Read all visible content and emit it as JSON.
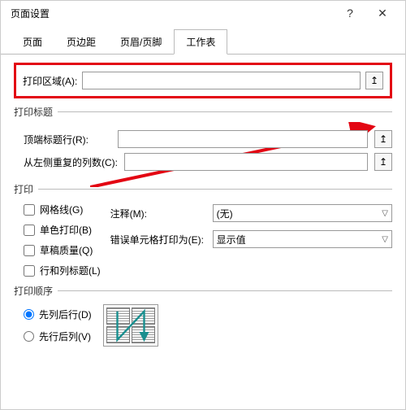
{
  "title": "页面设置",
  "titlebar": {
    "help": "?",
    "close": "✕"
  },
  "tabs": {
    "t0": "页面",
    "t1": "页边距",
    "t2": "页眉/页脚",
    "t3": "工作表"
  },
  "print_area": {
    "label": "打印区域(A):",
    "value": ""
  },
  "print_titles": {
    "legend": "打印标题",
    "top_rows_label": "顶端标题行(R):",
    "top_rows_value": "",
    "left_cols_label": "从左侧重复的列数(C):",
    "left_cols_value": ""
  },
  "print": {
    "legend": "打印",
    "gridlines": "网格线(G)",
    "black_white": "单色打印(B)",
    "draft": "草稿质量(Q)",
    "row_col_headings": "行和列标题(L)",
    "comments_label": "注释(M):",
    "comments_value": "(无)",
    "errors_label": "错误单元格打印为(E):",
    "errors_value": "显示值"
  },
  "order": {
    "legend": "打印顺序",
    "down_over": "先列后行(D)",
    "over_down": "先行后列(V)"
  },
  "icons": {
    "ref_arrow": "↥"
  }
}
